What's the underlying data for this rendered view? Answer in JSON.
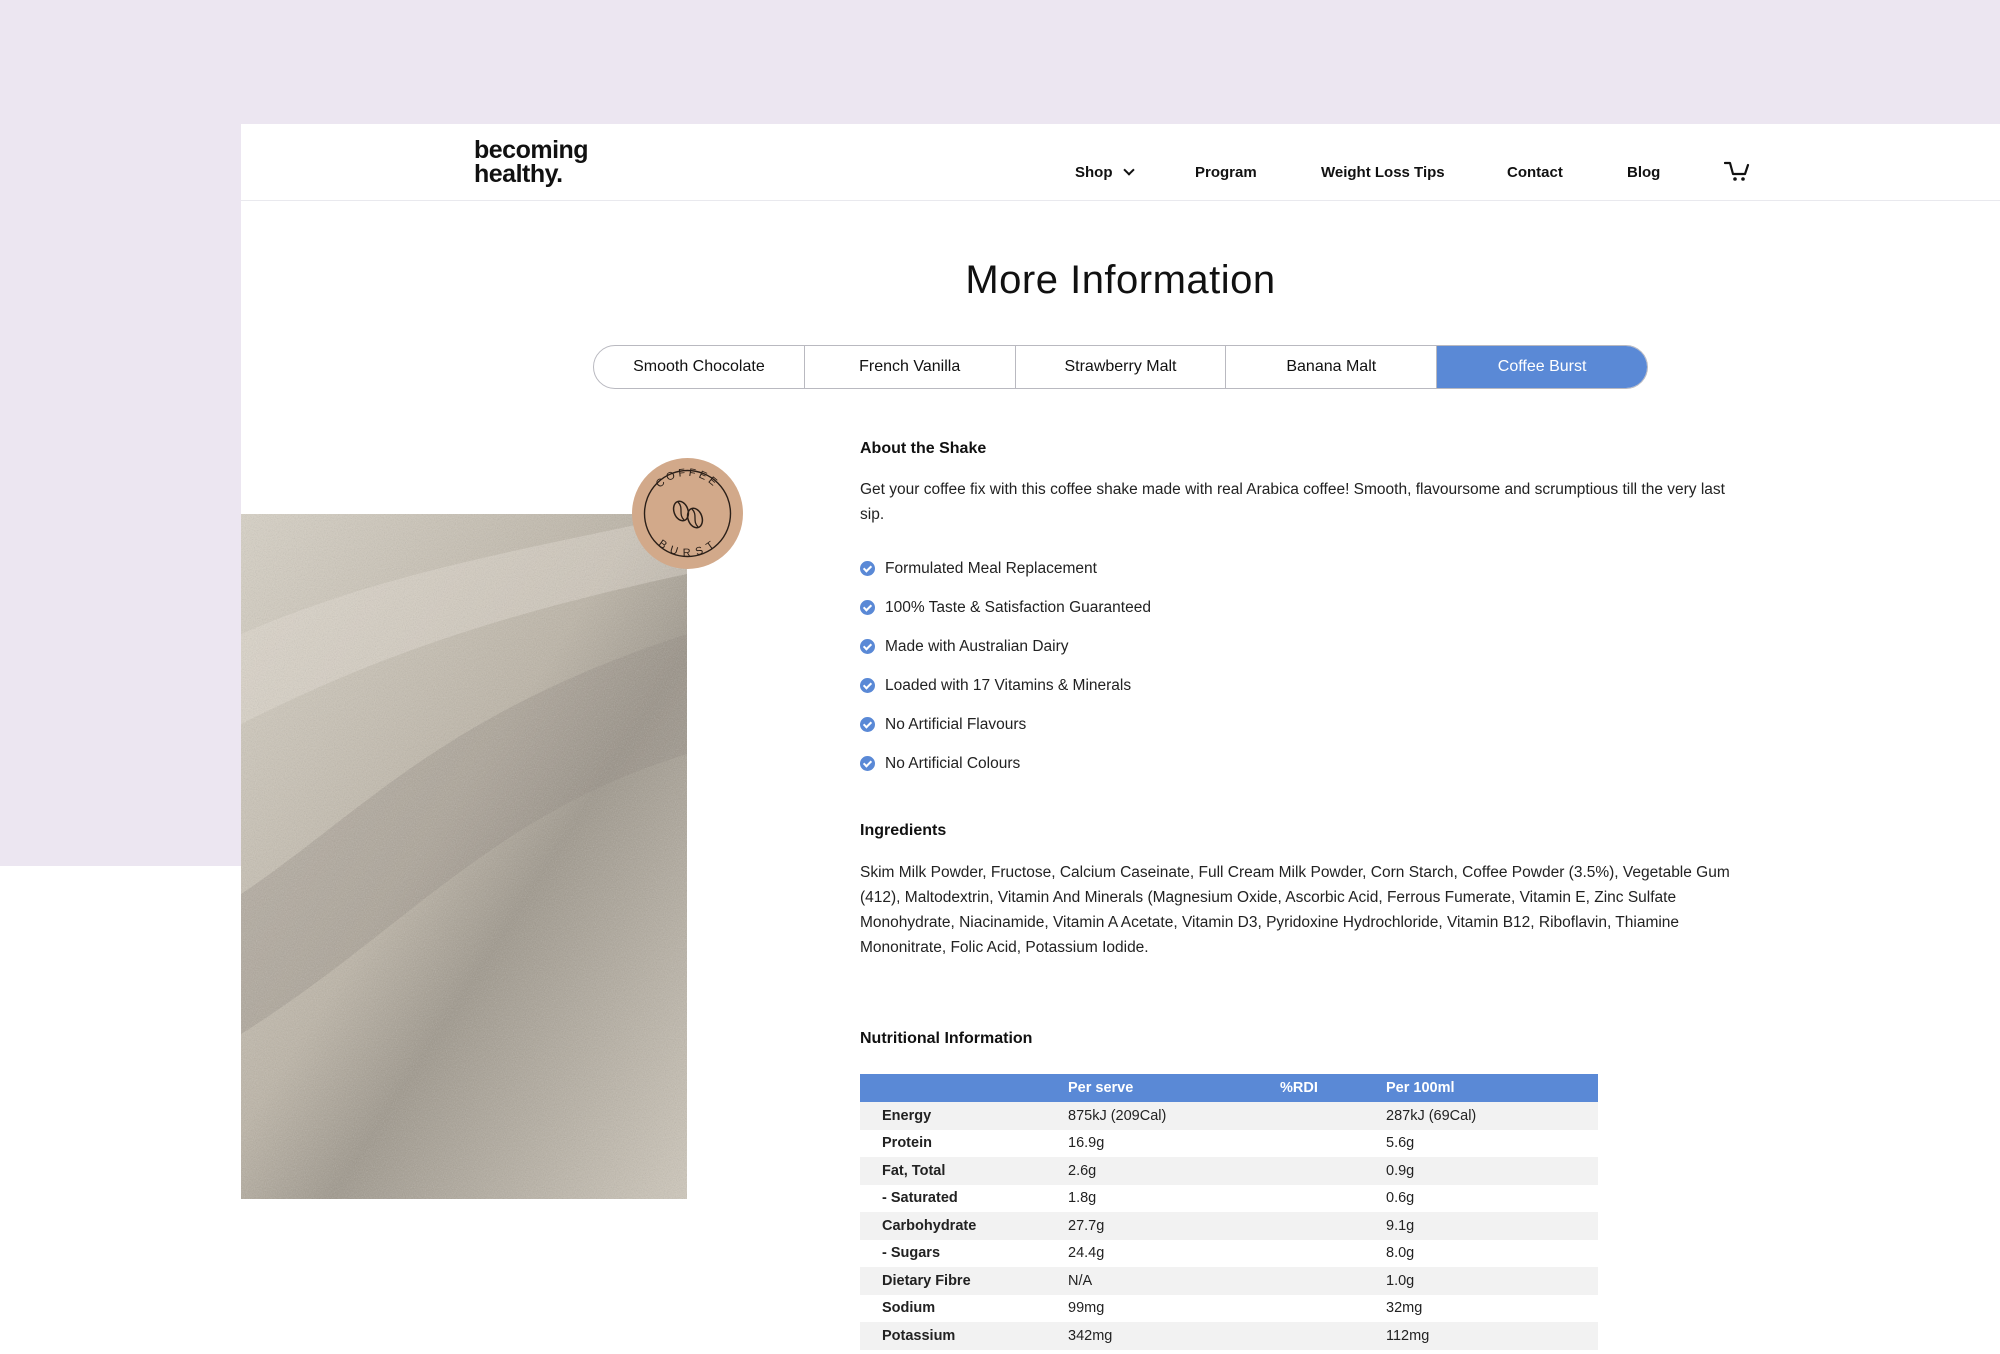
{
  "header": {
    "logo_line1": "becoming",
    "logo_line2": "healthy.",
    "nav": [
      "Shop",
      "Program",
      "Weight Loss Tips",
      "Contact",
      "Blog"
    ]
  },
  "page_title": "More Information",
  "tabs": [
    {
      "label": "Smooth Chocolate",
      "active": false
    },
    {
      "label": "French Vanilla",
      "active": false
    },
    {
      "label": "Strawberry Malt",
      "active": false
    },
    {
      "label": "Banana Malt",
      "active": false
    },
    {
      "label": "Coffee Burst",
      "active": true
    }
  ],
  "badge": {
    "top_text": "COFFEE",
    "bottom_text": "BURST"
  },
  "about": {
    "heading": "About the Shake",
    "text": "Get your coffee fix with this coffee shake made with real Arabica coffee! Smooth, flavoursome and scrumptious till the very last sip.",
    "features": [
      "Formulated Meal Replacement",
      "100% Taste & Satisfaction Guaranteed",
      "Made with Australian Dairy",
      "Loaded with 17 Vitamins & Minerals",
      "No Artificial Flavours",
      "No Artificial Colours"
    ]
  },
  "ingredients": {
    "heading": "Ingredients",
    "text": "Skim Milk Powder, Fructose, Calcium Caseinate, Full Cream Milk Powder, Corn Starch, Coffee Powder (3.5%), Vegetable Gum (412), Maltodextrin, Vitamin And Minerals (Magnesium Oxide, Ascorbic Acid, Ferrous Fumerate, Vitamin E, Zinc Sulfate Monohydrate, Niacinamide, Vitamin A Acetate, Vitamin D3, Pyridoxine Hydrochloride, Vitamin B12, Riboflavin, Thiamine Mononitrate, Folic Acid, Potassium Iodide."
  },
  "nutrition": {
    "heading": "Nutritional Information",
    "columns": [
      "",
      "Per serve",
      "%RDI",
      "Per 100ml"
    ],
    "rows": [
      [
        "Energy",
        "875kJ (209Cal)",
        "",
        "287kJ (69Cal)"
      ],
      [
        "Protein",
        "16.9g",
        "",
        "5.6g"
      ],
      [
        "Fat, Total",
        "2.6g",
        "",
        "0.9g"
      ],
      [
        "- Saturated",
        "1.8g",
        "",
        "0.6g"
      ],
      [
        "Carbohydrate",
        "27.7g",
        "",
        "9.1g"
      ],
      [
        "- Sugars",
        "24.4g",
        "",
        "8.0g"
      ],
      [
        "Dietary Fibre",
        "N/A",
        "",
        "1.0g"
      ],
      [
        "Sodium",
        "99mg",
        "",
        "32mg"
      ],
      [
        "Potassium",
        "342mg",
        "",
        "112mg"
      ]
    ]
  },
  "colors": {
    "accent": "#5a89d6",
    "lilac": "#ece6f1",
    "badge": "#d2a98a"
  }
}
